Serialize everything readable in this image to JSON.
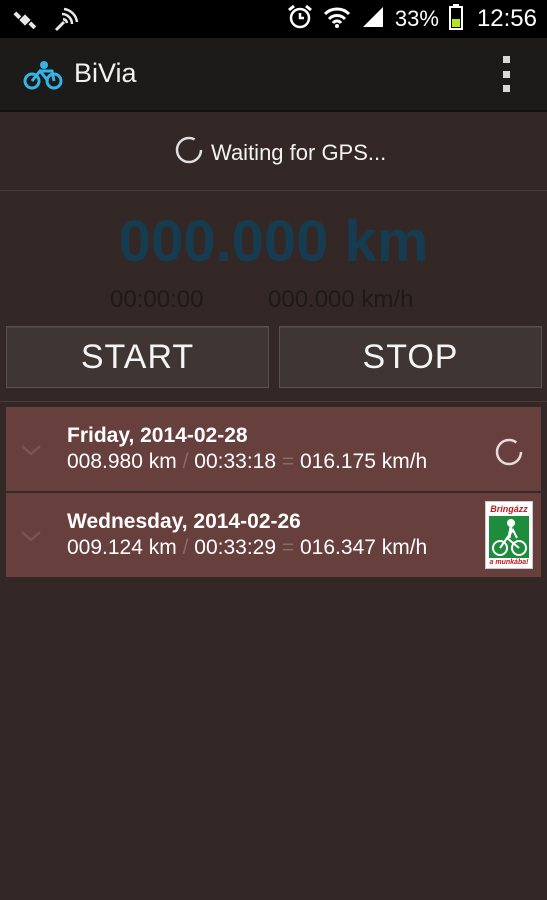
{
  "status_bar": {
    "battery": "33%",
    "time": "12:56"
  },
  "action_bar": {
    "title": "BiVia"
  },
  "gps": {
    "status": "Waiting for GPS..."
  },
  "tracker": {
    "distance": "000.000 km",
    "elapsed": "00:00:00",
    "speed": "000.000 km/h",
    "start_label": "START",
    "stop_label": "STOP"
  },
  "trips": [
    {
      "title": "Friday, 2014-02-28",
      "distance": "008.980 km",
      "sep1": "/",
      "duration": "00:33:18",
      "sep2": "=",
      "speed": "016.175 km/h",
      "status_icon": "loading-spinner-icon"
    },
    {
      "title": "Wednesday, 2014-02-26",
      "distance": "009.124 km",
      "sep1": "/",
      "duration": "00:33:29",
      "sep2": "=",
      "speed": "016.347 km/h",
      "badge_top": "Bringázz",
      "badge_bottom": "a munkába!"
    }
  ],
  "colors": {
    "background": "#332826",
    "trip_row": "#673f3c",
    "distance_text": "#163c52",
    "accent": "#33b5e5"
  }
}
